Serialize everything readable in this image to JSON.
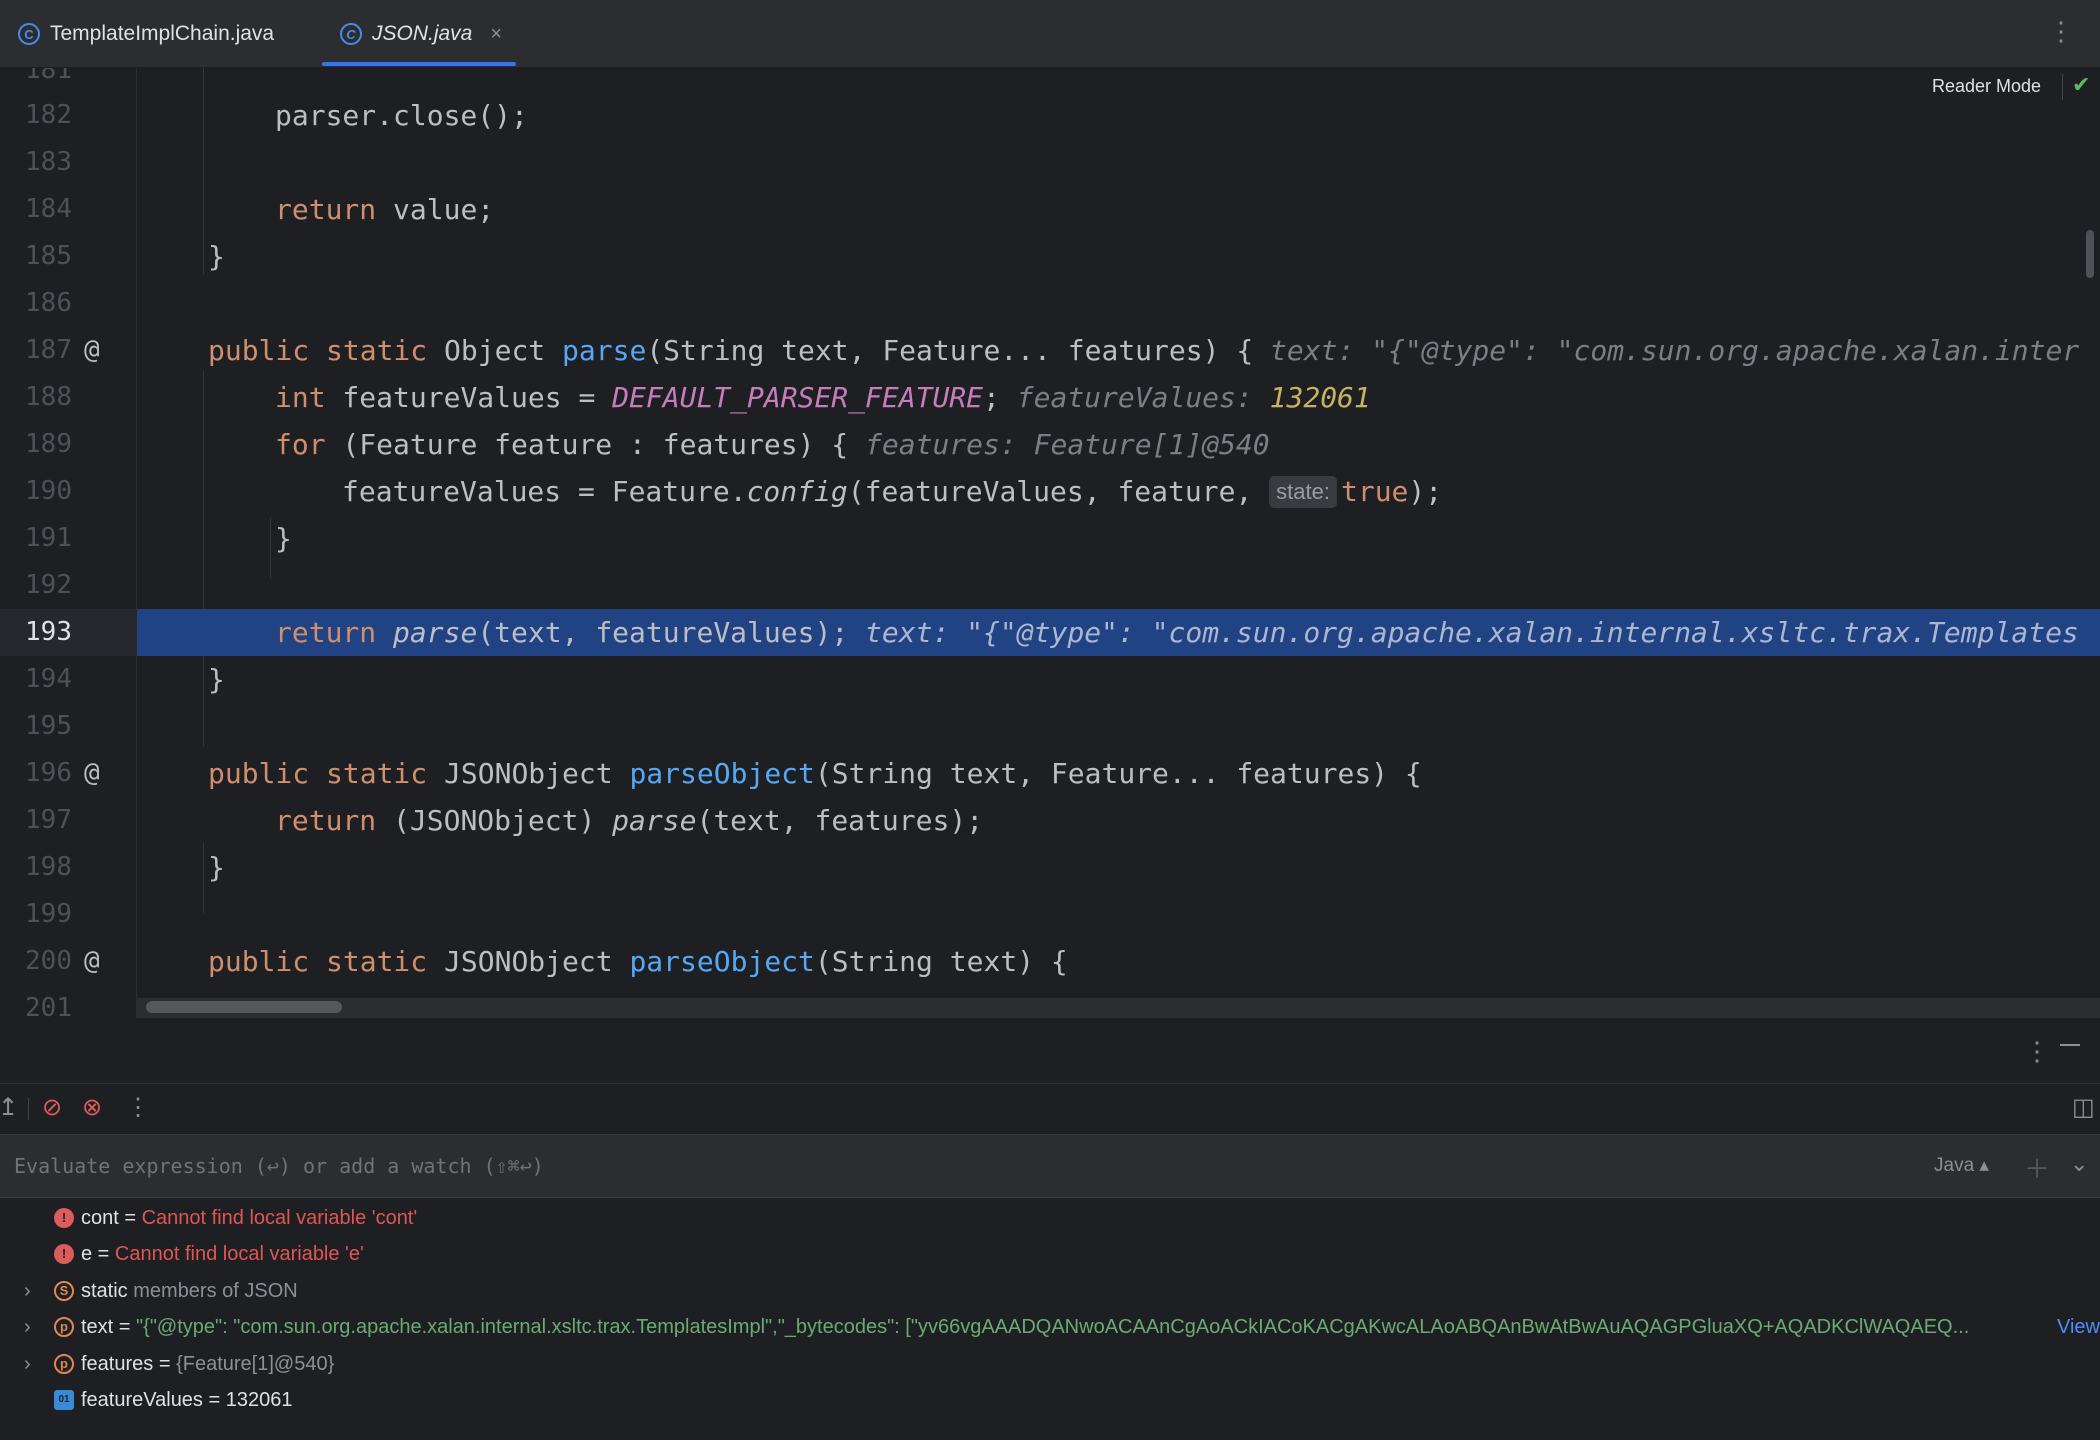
{
  "tabs": [
    {
      "label": "TemplateImplChain.java",
      "icon": "class-icon"
    },
    {
      "label": "JSON.java",
      "icon": "class-icon",
      "active": true
    }
  ],
  "editor": {
    "reader_mode": "Reader Mode",
    "lines": {
      "l181": "181",
      "l182": {
        "num": "182",
        "code": "parser.close();"
      },
      "l183": "183",
      "l184": {
        "num": "184",
        "kw": "return",
        "rest": " value;"
      },
      "l185": {
        "num": "185",
        "code": "}"
      },
      "l186": "186",
      "l187": {
        "num": "187",
        "gutter": "@",
        "kw": "public static",
        "t1": " Object ",
        "fn": "parse",
        "t2": "(String text, Feature... features) {",
        "hint": "text: \"{\"@type\": \"com.sun.org.apache.xalan.inter"
      },
      "l188": {
        "num": "188",
        "kw": "int",
        "t1": " featureValues = ",
        "const": "DEFAULT_PARSER_FEATURE",
        "t2": ";",
        "hint": "featureValues: ",
        "hintval": "132061"
      },
      "l189": {
        "num": "189",
        "kw": "for",
        "t1": " (Feature feature : features) {",
        "hint": "features: Feature[1]@540"
      },
      "l190": {
        "num": "190",
        "t1": "featureValues = Feature.",
        "it": "config",
        "t2": "(featureValues, feature, ",
        "badge": "state:",
        "kw": "true",
        "t3": ");"
      },
      "l191": {
        "num": "191",
        "code": "}"
      },
      "l192": "192",
      "l193": {
        "num": "193",
        "kw": "return",
        "it": "parse",
        "t1": "(text, featureValues);",
        "hint": "text: \"{\"@type\": \"com.sun.org.apache.xalan.internal.xsltc.trax.Templates"
      },
      "l194": {
        "num": "194",
        "code": "}"
      },
      "l195": "195",
      "l196": {
        "num": "196",
        "gutter": "@",
        "kw": "public static",
        "t1": " JSONObject ",
        "fn": "parseObject",
        "t2": "(String text, Feature... features) {"
      },
      "l197": {
        "num": "197",
        "kw": "return",
        "t1": " (JSONObject) ",
        "it": "parse",
        "t2": "(text, features);"
      },
      "l198": {
        "num": "198",
        "code": "}"
      },
      "l199": "199",
      "l200": {
        "num": "200",
        "gutter": "@",
        "kw": "public static",
        "t1": " JSONObject ",
        "fn": "parseObject",
        "t2": "(String text) {"
      },
      "l201": "201"
    }
  },
  "debug": {
    "eval_placeholder": "Evaluate expression (↩) or add a watch (⇧⌘↩)",
    "language": "Java",
    "vars": [
      {
        "name": "cont",
        "eq": " = ",
        "value": "Cannot find local variable 'cont'"
      },
      {
        "name": "e",
        "eq": " = ",
        "value": "Cannot find local variable 'e'"
      },
      {
        "name": "static",
        "value": " members of JSON"
      },
      {
        "name": "text",
        "eq": " = ",
        "value": "\"{\"@type\": \"com.sun.org.apache.xalan.internal.xsltc.trax.TemplatesImpl\",\"_bytecodes\": [\"yv66vgAAADQANwoACAAnCgAoACkIACoKACgAKwcALAoABQAnBwAtBwAuAQAGPGluaXQ+AQADKClWAQAEQ...",
        "link": "View"
      },
      {
        "name": "features",
        "eq": " = ",
        "value": "{Feature[1]@540}"
      },
      {
        "name": "featureValues",
        "eq": " = ",
        "value": "132061"
      }
    ]
  },
  "colors": {
    "accent": "#3574f0",
    "current_line": "#214283",
    "keyword": "#cf8e6d",
    "function": "#56a8f5",
    "string": "#6aab73",
    "error": "#e05555"
  }
}
